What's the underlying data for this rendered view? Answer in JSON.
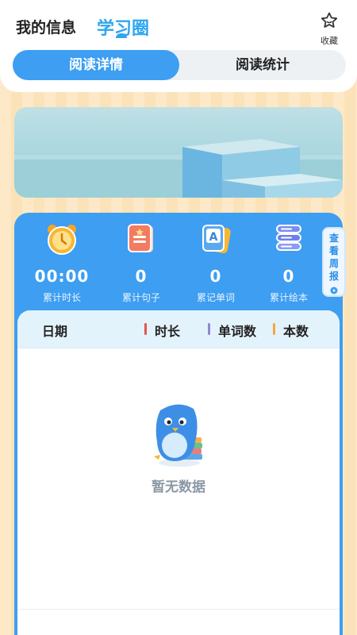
{
  "header": {
    "tabs": [
      {
        "label": "我的信息"
      },
      {
        "label": "学习圈"
      }
    ],
    "favorite_label": "收藏"
  },
  "segment": {
    "options": [
      "阅读详情",
      "阅读统计"
    ],
    "selected": "阅读详情"
  },
  "stats": [
    {
      "icon": "alarm-clock-icon",
      "value": "00:00",
      "label": "累计时长"
    },
    {
      "icon": "sentence-book-icon",
      "value": "0",
      "label": "累计句子"
    },
    {
      "icon": "word-card-icon",
      "value": "0",
      "label": "累记单词"
    },
    {
      "icon": "book-stack-icon",
      "value": "0",
      "label": "累计绘本"
    }
  ],
  "weekly_report": {
    "chars": [
      "查",
      "看",
      "周",
      "报"
    ]
  },
  "table": {
    "columns": [
      "日期",
      "时长",
      "单词数",
      "本数"
    ],
    "column_bar_colors": [
      "#e5534b",
      "#8f86d6",
      "#f2a83b"
    ],
    "empty_text": "暂无数据"
  },
  "colors": {
    "accent": "#3d9ef2",
    "active_tab": "#2ea6ee"
  }
}
